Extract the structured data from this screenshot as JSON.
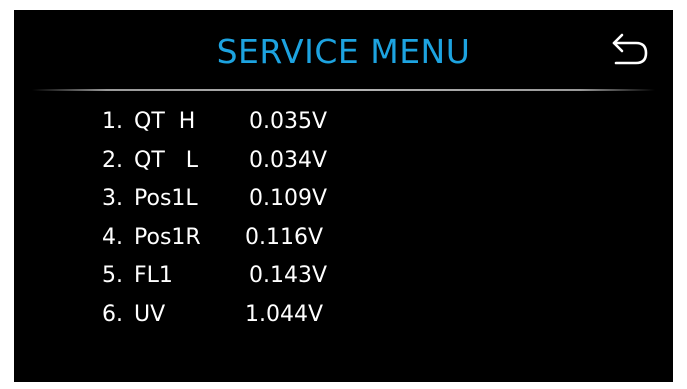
{
  "header": {
    "title": "SERVICE MENU",
    "back_icon": "undo-arrow-icon"
  },
  "colors": {
    "background": "#000000",
    "title": "#1da3e0",
    "text": "#ffffff",
    "divider": "#b4b4b4"
  },
  "items": [
    {
      "number": "1.",
      "name": "QT  H",
      "value": "0.035V"
    },
    {
      "number": "2.",
      "name": "QT   L",
      "value": "0.034V"
    },
    {
      "number": "3.",
      "name": "Pos1L",
      "value": "0.109V"
    },
    {
      "number": "4.",
      "name": "Pos1R",
      "value": "0.116V"
    },
    {
      "number": "5.",
      "name": "FL1",
      "value": "0.143V"
    },
    {
      "number": "6.",
      "name": "UV",
      "value": "1.044V"
    }
  ]
}
